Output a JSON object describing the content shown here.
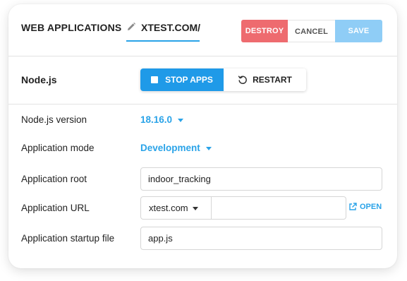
{
  "header": {
    "title": "WEB APPLICATIONS",
    "domain": "XTEST.COM/",
    "buttons": {
      "destroy": "DESTROY",
      "cancel": "CANCEL",
      "save": "SAVE"
    }
  },
  "app": {
    "name": "Node.js",
    "stop_label": "STOP APPS",
    "restart_label": "RESTART"
  },
  "form": {
    "version": {
      "label": "Node.js version",
      "value": "18.16.0"
    },
    "mode": {
      "label": "Application mode",
      "value": "Development"
    },
    "root": {
      "label": "Application root",
      "value": "indoor_tracking"
    },
    "url": {
      "label": "Application URL",
      "domain": "xtest.com",
      "path": "",
      "open_label": "OPEN"
    },
    "startup": {
      "label": "Application startup file",
      "value": "app.js"
    }
  },
  "colors": {
    "accent": "#2aa3e8",
    "destroy": "#ee6b6f",
    "save": "#8fcdf6",
    "stop": "#1f9ae8"
  },
  "icons": [
    "pencil-icon",
    "stop-icon",
    "restart-icon",
    "chevron-down-icon",
    "external-link-icon"
  ]
}
